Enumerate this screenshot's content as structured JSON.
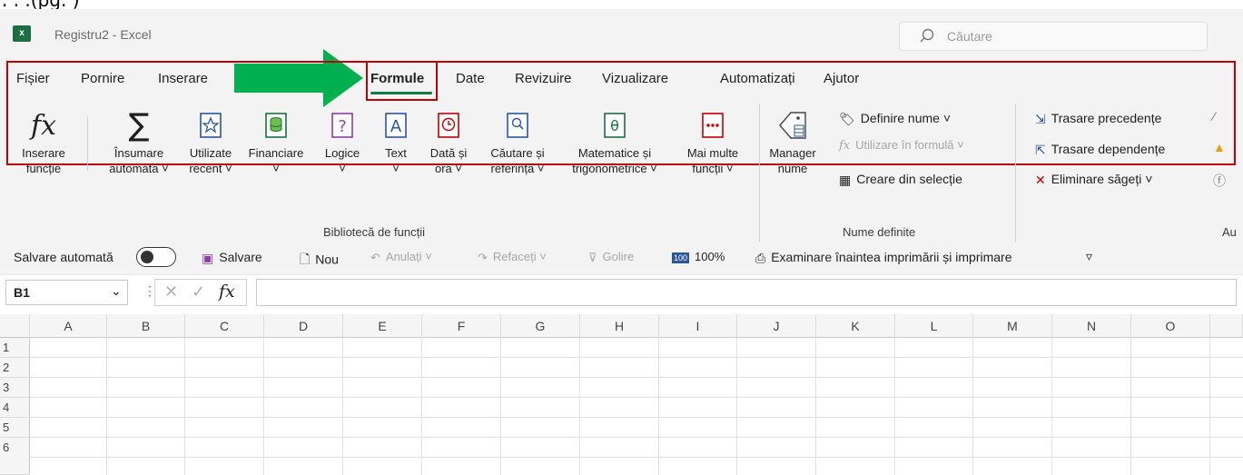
{
  "title": {
    "app_name": "Registru2 - Excel",
    "search_placeholder": "Căutare"
  },
  "tabs": [
    {
      "label": "Fișier"
    },
    {
      "label": "Pornire"
    },
    {
      "label": "Inserare"
    },
    {
      "label": "Formule",
      "active": true
    },
    {
      "label": "Date"
    },
    {
      "label": "Revizuire"
    },
    {
      "label": "Vizualizare"
    },
    {
      "label": "Automatizați"
    },
    {
      "label": "Ajutor"
    }
  ],
  "function_library": {
    "group_label": "Bibliotecă de funcții",
    "buttons": [
      {
        "line1": "Inserare",
        "line2": "funcție",
        "icon": "fx-icon"
      },
      {
        "line1": "Însumare",
        "line2": "automată ˅",
        "icon": "sigma-icon"
      },
      {
        "line1": "Utilizate",
        "line2": "recent ˅",
        "icon": "star-book-icon"
      },
      {
        "line1": "Financiare",
        "line2": "˅",
        "icon": "database-book-icon"
      },
      {
        "line1": "Logice",
        "line2": "˅",
        "icon": "question-book-icon"
      },
      {
        "line1": "Text",
        "line2": "˅",
        "icon": "text-book-icon"
      },
      {
        "line1": "Dată și",
        "line2": "oră ˅",
        "icon": "clock-book-icon"
      },
      {
        "line1": "Căutare și",
        "line2": "referință ˅",
        "icon": "search-book-icon"
      },
      {
        "line1": "Matematice și",
        "line2": "trigonometrice ˅",
        "icon": "theta-book-icon"
      },
      {
        "line1": "Mai multe",
        "line2": "funcții ˅",
        "icon": "more-book-icon"
      }
    ]
  },
  "defined_names": {
    "group_label": "Nume definite",
    "manager_line1": "Manager",
    "manager_line2": "nume",
    "define_name": "Definire nume ˅",
    "use_in_formula": "Utilizare în formulă ˅",
    "create_from_selection": "Creare din selecție"
  },
  "formula_auditing": {
    "group_label": "Au",
    "trace_precedents": "Trasare precedențe",
    "trace_dependents": "Trasare dependențe",
    "remove_arrows": "Eliminare săgeți ˅"
  },
  "quick_access": {
    "autosave_label": "Salvare automată",
    "autosave_state": "Dezactivat",
    "save": "Salvare",
    "new": "Nou",
    "undo": "Anulați ˅",
    "redo": "Refaceți ˅",
    "clear": "Golire",
    "zoom": "100%",
    "print_preview": "Examinare înaintea imprimării și imprimare"
  },
  "formula_bar": {
    "name_box": "B1",
    "formula": ""
  },
  "sheet": {
    "columns": [
      "A",
      "B",
      "C",
      "D",
      "E",
      "F",
      "G",
      "H",
      "I",
      "J",
      "K",
      "L",
      "M",
      "N",
      "O"
    ],
    "rows": [
      "1",
      "2",
      "3",
      "4",
      "5",
      "6"
    ]
  },
  "colors": {
    "accent": "#107c41",
    "highlight": "#c00000",
    "arrow": "#00b050"
  }
}
